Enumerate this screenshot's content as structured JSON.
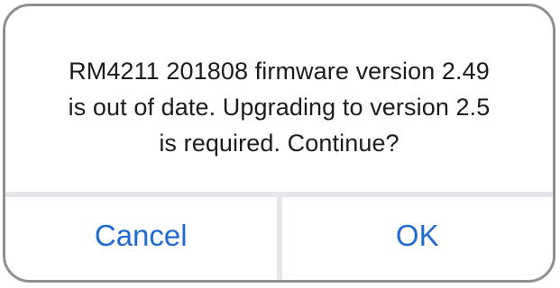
{
  "alert": {
    "message_lines": [
      "RM4211 201808 firmware version 2.49",
      "is out of date. Upgrading to version 2.5",
      "is required. Continue?"
    ],
    "cancel_label": "Cancel",
    "ok_label": "OK"
  },
  "colors": {
    "accent": "#1e6bd1",
    "text": "#1c1c1e",
    "separator": "#e5e5ea",
    "border": "#8e8e93"
  }
}
